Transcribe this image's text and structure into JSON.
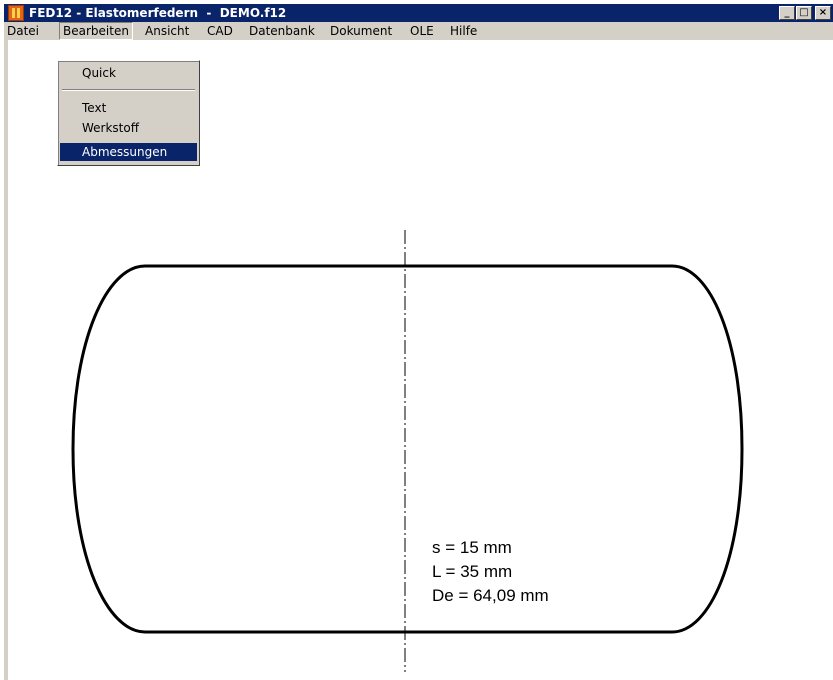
{
  "window": {
    "title": "FED12 - Elastomerfedern  -  DEMO.f12",
    "controls": {
      "minimize": "_",
      "maximize": "□",
      "close": "×"
    }
  },
  "menubar": {
    "items": [
      {
        "label": "Datei"
      },
      {
        "label": "Bearbeiten"
      },
      {
        "label": "Ansicht"
      },
      {
        "label": "CAD"
      },
      {
        "label": "Datenbank"
      },
      {
        "label": "Dokument"
      },
      {
        "label": "OLE"
      },
      {
        "label": "Hilfe"
      }
    ]
  },
  "dropdown": {
    "items": [
      {
        "label": "Quick"
      },
      {
        "label": "Text"
      },
      {
        "label": "Werkstoff"
      },
      {
        "label": "Abmessungen",
        "selected": true
      }
    ]
  },
  "drawing": {
    "dimensions": [
      {
        "text": "s = 15 mm"
      },
      {
        "text": "L = 35 mm"
      },
      {
        "text": "De = 64,09 mm"
      }
    ]
  },
  "colors": {
    "titlebar": "#0a246a",
    "menu_face": "#d4d0c8",
    "selection": "#0a246a",
    "outline": "#000000"
  }
}
